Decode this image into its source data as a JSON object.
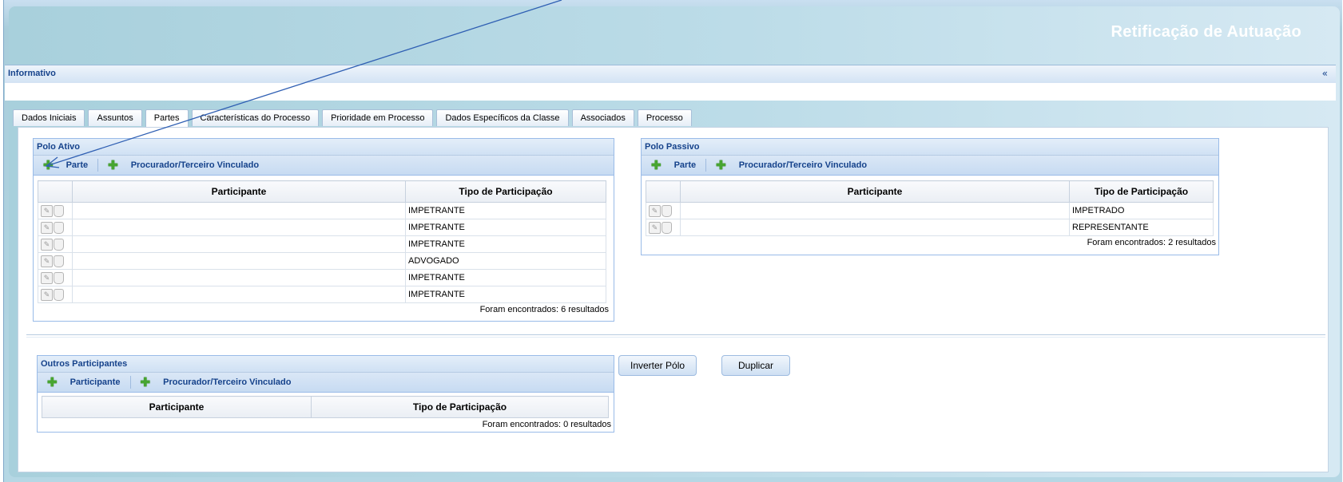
{
  "window": {
    "title": "Retificação de Autuação"
  },
  "informativo": {
    "label": "Informativo",
    "collapse_icon": "«"
  },
  "tabs": [
    {
      "label": "Dados Iniciais"
    },
    {
      "label": "Assuntos"
    },
    {
      "label": "Partes",
      "active": true
    },
    {
      "label": "Características do Processo"
    },
    {
      "label": "Prioridade em Processo"
    },
    {
      "label": "Dados Específicos da Classe"
    },
    {
      "label": "Associados"
    },
    {
      "label": "Processo"
    }
  ],
  "polo_ativo": {
    "title": "Polo Ativo",
    "toolbar": {
      "btn1": "Parte",
      "btn2": "Procurador/Terceiro Vinculado"
    },
    "columns": {
      "participante": "Participante",
      "tipo": "Tipo de Participação"
    },
    "rows": [
      {
        "participante": "",
        "tipo": "IMPETRANTE"
      },
      {
        "participante": "",
        "tipo": "IMPETRANTE"
      },
      {
        "participante": "",
        "tipo": "IMPETRANTE"
      },
      {
        "participante": "",
        "tipo": "ADVOGADO"
      },
      {
        "participante": "",
        "tipo": "IMPETRANTE"
      },
      {
        "participante": "",
        "tipo": "IMPETRANTE"
      }
    ],
    "result": "Foram encontrados: 6 resultados"
  },
  "polo_passivo": {
    "title": "Polo Passivo",
    "toolbar": {
      "btn1": "Parte",
      "btn2": "Procurador/Terceiro Vinculado"
    },
    "columns": {
      "participante": "Participante",
      "tipo": "Tipo de Participação"
    },
    "rows": [
      {
        "participante": "",
        "tipo": "IMPETRADO"
      },
      {
        "participante": "",
        "tipo": "REPRESENTANTE"
      }
    ],
    "result": "Foram encontrados: 2 resultados"
  },
  "outros": {
    "title": "Outros Participantes",
    "toolbar": {
      "btn1": "Participante",
      "btn2": "Procurador/Terceiro Vinculado"
    },
    "columns": {
      "participante": "Participante",
      "tipo": "Tipo de Participação"
    },
    "result": "Foram encontrados: 0 resultados"
  },
  "actions": {
    "inverter": "Inverter Pólo",
    "duplicar": "Duplicar"
  },
  "colors": {
    "header_text": "#15428b",
    "add_icon": "#47a531",
    "annotation_arrow": "#2f5fb3"
  }
}
